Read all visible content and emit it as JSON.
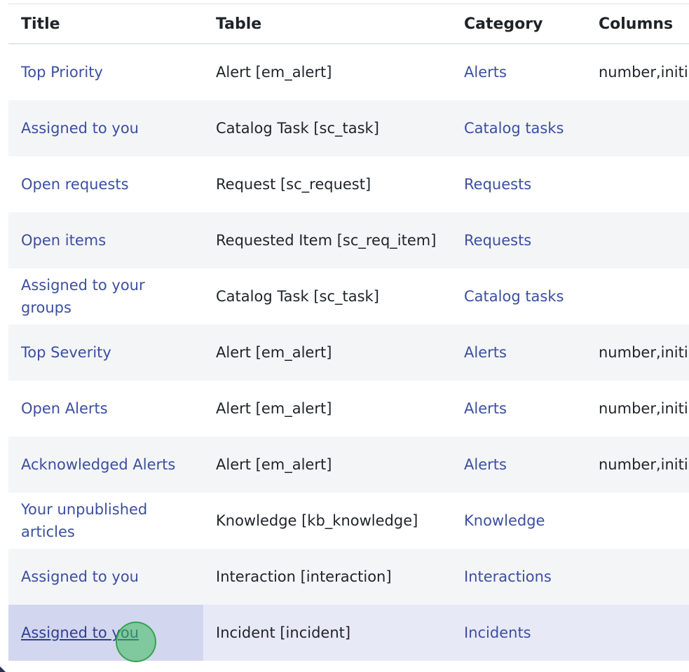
{
  "columns": {
    "title": "Title",
    "table": "Table",
    "category": "Category",
    "columns": "Columns"
  },
  "rows": [
    {
      "title": "Top Priority",
      "table": "Alert [em_alert]",
      "category": "Alerts",
      "columns": "number,initi"
    },
    {
      "title": "Assigned to you",
      "table": "Catalog Task [sc_task]",
      "category": "Catalog tasks",
      "columns": ""
    },
    {
      "title": "Open requests",
      "table": "Request [sc_request]",
      "category": "Requests",
      "columns": ""
    },
    {
      "title": "Open items",
      "table": "Requested Item [sc_req_item]",
      "category": "Requests",
      "columns": ""
    },
    {
      "title": "Assigned to your groups",
      "table": "Catalog Task [sc_task]",
      "category": "Catalog tasks",
      "columns": ""
    },
    {
      "title": "Top Severity",
      "table": "Alert [em_alert]",
      "category": "Alerts",
      "columns": "number,initi"
    },
    {
      "title": "Open Alerts",
      "table": "Alert [em_alert]",
      "category": "Alerts",
      "columns": "number,initi"
    },
    {
      "title": "Acknowledged Alerts",
      "table": "Alert [em_alert]",
      "category": "Alerts",
      "columns": "number,initi"
    },
    {
      "title": "Your unpublished articles",
      "table": "Knowledge [kb_knowledge]",
      "category": "Knowledge",
      "columns": ""
    },
    {
      "title": "Assigned to you",
      "table": "Interaction [interaction]",
      "category": "Interactions",
      "columns": ""
    },
    {
      "title": "Assigned to you",
      "table": "Incident [incident]",
      "category": "Incidents",
      "columns": ""
    }
  ],
  "selected_row_index": 10,
  "colors": {
    "link": "#3b4fa0",
    "text": "#1f2328",
    "row_alt": "#f4f5f7",
    "selected_row": "#e8e9f6",
    "cursor": "#3cbe5a"
  }
}
